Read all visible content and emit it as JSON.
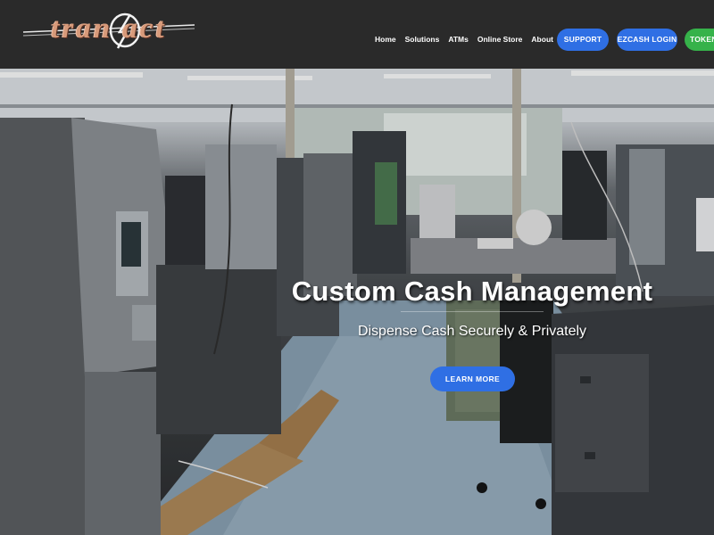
{
  "brand": {
    "logo_text": "tran act"
  },
  "nav": {
    "items": [
      {
        "label": "Home"
      },
      {
        "label": "Solutions"
      },
      {
        "label": "ATMs"
      },
      {
        "label": "Online Store"
      },
      {
        "label": "About"
      }
    ]
  },
  "header_buttons": {
    "support": "SUPPORT",
    "ezcash_login": "EZCASH LOGIN",
    "token": "TOKEN"
  },
  "hero": {
    "title": "Custom Cash Management",
    "subtitle": "Dispense Cash Securely & Privately",
    "cta": "LEARN MORE"
  },
  "colors": {
    "header_bg": "#2a2a2a",
    "primary_blue": "#2f6fe4",
    "token_green": "#36b24a",
    "logo_copper": "#d79a7a"
  }
}
